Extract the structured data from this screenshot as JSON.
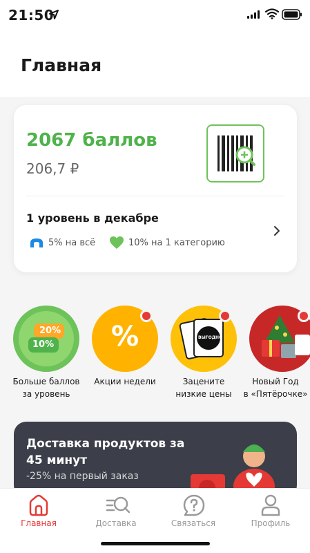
{
  "status_bar": {
    "time": "21:50"
  },
  "header": {
    "title": "Главная"
  },
  "loyalty": {
    "points": "2067 баллов",
    "rubles": "206,7 ₽",
    "level_title": "1 уровень в декабре",
    "benefits": [
      "5% на всё",
      "10% на 1 категорию"
    ]
  },
  "stories": [
    {
      "label_line1": "Больше баллов",
      "label_line2": "за уровень",
      "badge_top": "20%",
      "badge_bottom": "10%"
    },
    {
      "label_line1": "Акции недели",
      "label_line2": "",
      "symbol": "%"
    },
    {
      "label_line1": "Зацените",
      "label_line2": "низкие цены",
      "card_text": "ВЫГОДНО"
    },
    {
      "label_line1": "Новый Год",
      "label_line2": "в «Пятёрочке»"
    }
  ],
  "banner": {
    "title": "Доставка продуктов за 45 минут",
    "subtitle": "-25% на первый заказ"
  },
  "nav": [
    {
      "label": "Главная",
      "icon": "home-icon"
    },
    {
      "label": "Доставка",
      "icon": "delivery-search-icon"
    },
    {
      "label": "Связаться",
      "icon": "help-chat-icon"
    },
    {
      "label": "Профиль",
      "icon": "profile-icon"
    }
  ],
  "colors": {
    "accent_red": "#e53935",
    "points_green": "#4fb24a",
    "banner_dark": "#3c3f49"
  }
}
